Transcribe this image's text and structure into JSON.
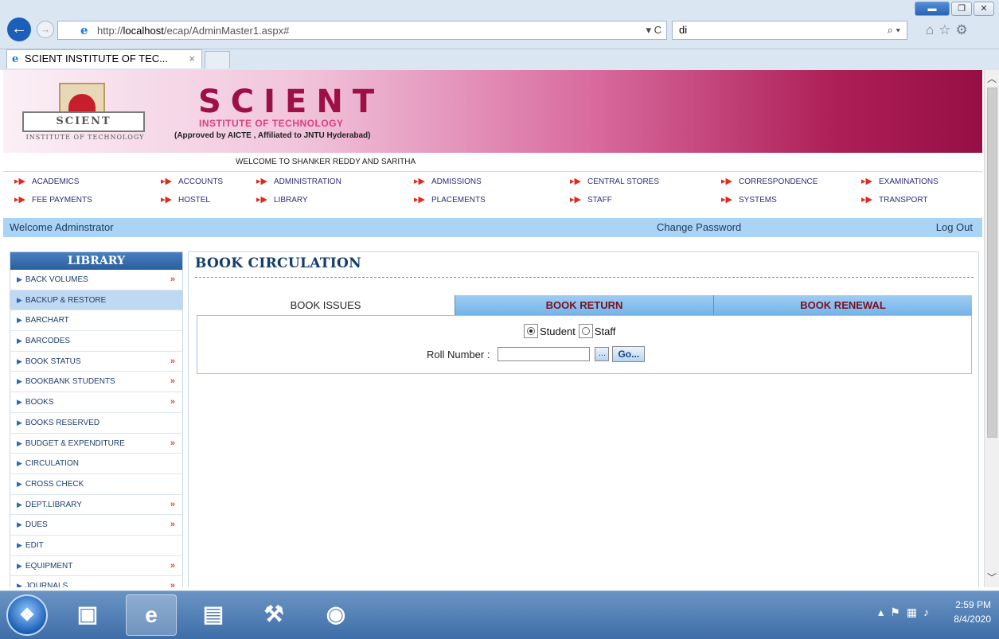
{
  "browser": {
    "url_prefix": "http://",
    "url_host": "localhost",
    "url_path": "/ecap/AdminMaster1.aspx#",
    "search_value": "di",
    "tab_title": "SCIENT INSTITUTE OF TEC...",
    "tab_close": "×",
    "refresh_controls": "▾ C"
  },
  "header": {
    "logo_text": "SCIENT",
    "logo_sub": "INSTITUTE OF TECHNOLOGY",
    "brand": "SCIENT",
    "brand_sub": "INSTITUTE OF TECHNOLOGY",
    "brand_note": "(Approved by AICTE , Affiliated to JNTU Hyderabad)",
    "welcome": "WELCOME TO SHANKER REDDY AND SARITHA"
  },
  "menu": {
    "row1": [
      "ACADEMICS",
      "ACCOUNTS",
      "ADMINISTRATION",
      "ADMISSIONS",
      "CENTRAL STORES",
      "CORRESPONDENCE",
      "EXAMINATIONS"
    ],
    "row2": [
      "FEE PAYMENTS",
      "HOSTEL",
      "LIBRARY",
      "PLACEMENTS",
      "STAFF",
      "SYSTEMS",
      "TRANSPORT"
    ]
  },
  "userbar": {
    "welcome": "Welcome Adminstrator",
    "change_password": "Change Password",
    "logout": "Log Out"
  },
  "sidebar": {
    "title": "LIBRARY",
    "items": [
      {
        "label": "BACK VOLUMES",
        "more": "»"
      },
      {
        "label": "BACKUP & RESTORE",
        "more": ""
      },
      {
        "label": "BARCHART",
        "more": ""
      },
      {
        "label": "BARCODES",
        "more": ""
      },
      {
        "label": "BOOK STATUS",
        "more": "»"
      },
      {
        "label": "BOOKBANK STUDENTS",
        "more": "»"
      },
      {
        "label": "BOOKS",
        "more": "»"
      },
      {
        "label": "BOOKS RESERVED",
        "more": ""
      },
      {
        "label": "BUDGET & EXPENDITURE",
        "more": "»"
      },
      {
        "label": "CIRCULATION",
        "more": ""
      },
      {
        "label": "CROSS CHECK",
        "more": ""
      },
      {
        "label": "DEPT.LIBRARY",
        "more": "»"
      },
      {
        "label": "DUES",
        "more": "»"
      },
      {
        "label": "EDIT",
        "more": ""
      },
      {
        "label": "EQUIPMENT",
        "more": "»"
      },
      {
        "label": "JOURNALS",
        "more": "»"
      }
    ]
  },
  "main": {
    "title": "BOOK CIRCULATION",
    "tabs": [
      "BOOK ISSUES",
      "BOOK RETURN",
      "BOOK RENEWAL"
    ],
    "radio_student": "Student",
    "radio_staff": "Staff",
    "roll_label": "Roll Number :",
    "roll_value": "",
    "dots_label": "...",
    "go_label": "Go..."
  },
  "taskbar": {
    "time": "2:59 PM",
    "date": "8/4/2020"
  }
}
